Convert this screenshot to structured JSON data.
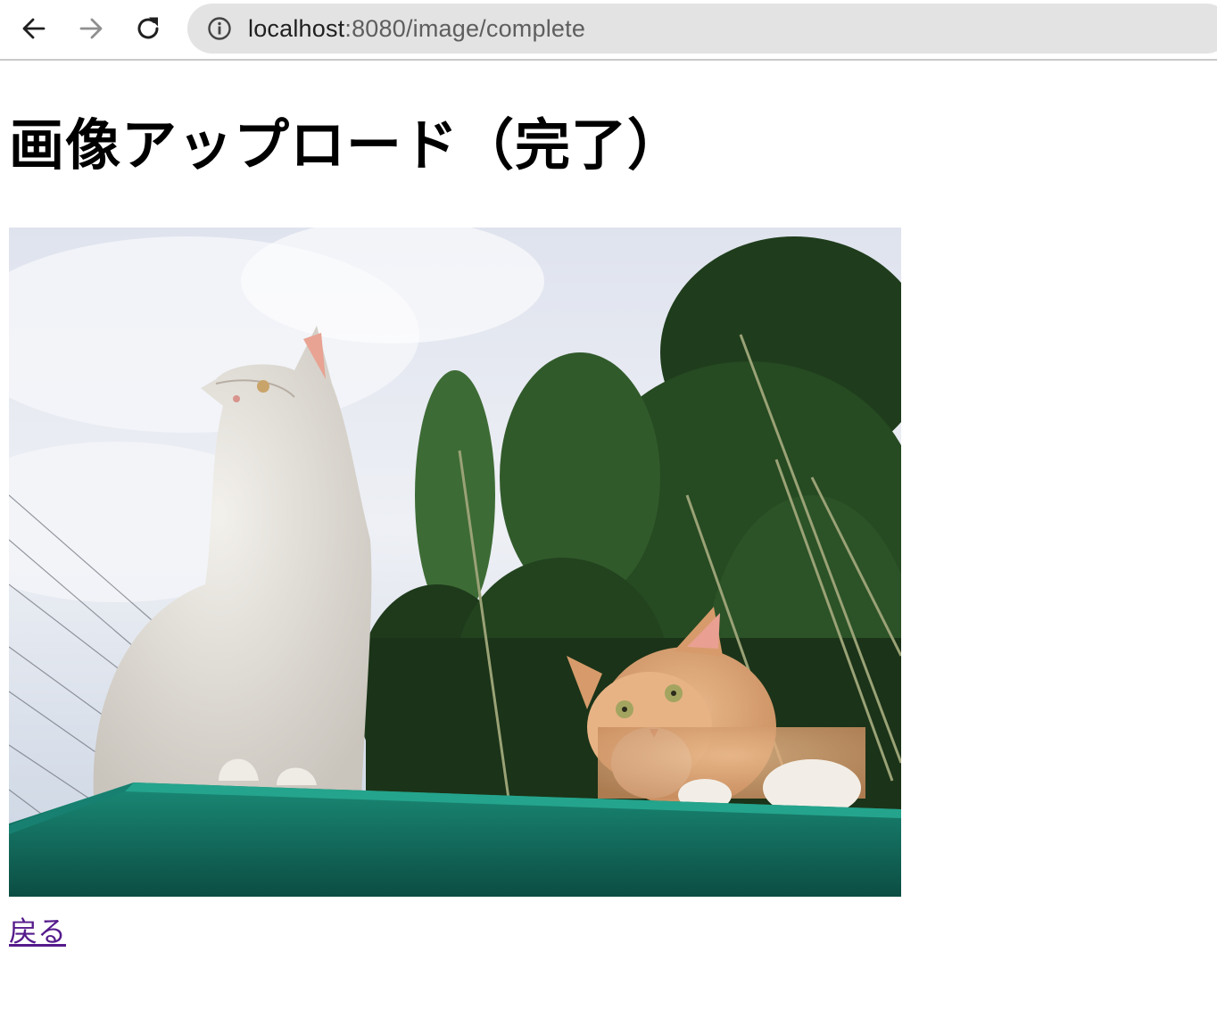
{
  "browser": {
    "url_host": "localhost",
    "url_path": ":8080/image/complete",
    "back_icon": "arrow-left-icon",
    "forward_icon": "arrow-right-icon",
    "reload_icon": "reload-icon",
    "site_info_icon": "info-icon"
  },
  "page": {
    "title": "画像アップロード（完了）",
    "image_description": "uploaded-photo-two-cats",
    "back_link": "戻る"
  },
  "colors": {
    "link_visited": "#551a8b",
    "omnibox_bg": "#e3e3e3",
    "table_teal": "#1a8a76"
  }
}
